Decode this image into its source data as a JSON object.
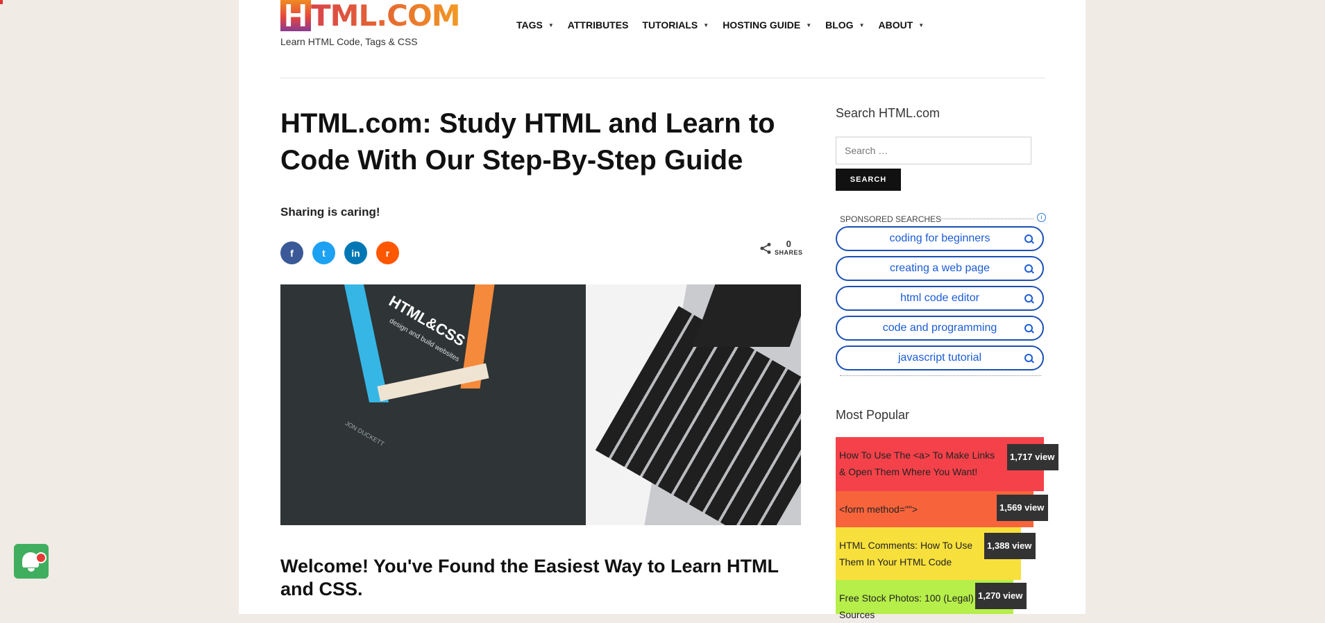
{
  "header": {
    "logo_h": "H",
    "logo_rest": "TML.COM",
    "tagline": "Learn HTML Code, Tags & CSS",
    "nav": [
      {
        "label": "TAGS",
        "has_caret": true
      },
      {
        "label": "ATTRIBUTES",
        "has_caret": false
      },
      {
        "label": "TUTORIALS",
        "has_caret": true
      },
      {
        "label": "HOSTING GUIDE",
        "has_caret": true
      },
      {
        "label": "BLOG",
        "has_caret": true
      },
      {
        "label": "ABOUT",
        "has_caret": true
      }
    ]
  },
  "main": {
    "title": "HTML.com: Study HTML and Learn to Code With Our Step-By-Step Guide",
    "sharing_text": "Sharing is caring!",
    "social": [
      {
        "icon": "facebook-icon",
        "glyph": "f",
        "color": "#3b5998"
      },
      {
        "icon": "twitter-icon",
        "glyph": "t",
        "color": "#1da1f2"
      },
      {
        "icon": "linkedin-icon",
        "glyph": "in",
        "color": "#0077b5"
      },
      {
        "icon": "reddit-icon",
        "glyph": "r",
        "color": "#ff5700"
      }
    ],
    "shares_count": "0",
    "shares_label": "SHARES",
    "hero": {
      "book_title": "HTML&CSS",
      "book_subtitle": "design and build websites",
      "book_author": "JON DUCKETT"
    },
    "welcome_heading": "Welcome! You've Found the Easiest Way to Learn HTML and CSS."
  },
  "sidebar": {
    "search_heading": "Search HTML.com",
    "search_placeholder": "Search …",
    "search_button": "SEARCH",
    "sponsored_label": "SPONSORED SEARCHES",
    "sponsored": [
      "coding for beginners",
      "creating a web page",
      "html code editor",
      "code and programming",
      "javascript tutorial"
    ],
    "popular_heading": "Most Popular",
    "popular": [
      {
        "title": "How To Use The <a> To Make Links & Open Them Where You Want!",
        "views": "1,717 view",
        "color": "#f5424a"
      },
      {
        "title": "<form method=\"\">",
        "views": "1,569 view",
        "color": "#f7643c"
      },
      {
        "title": "HTML Comments: How To Use Them In Your HTML Code",
        "views": "1,388 view",
        "color": "#f7e03c"
      },
      {
        "title": "Free Stock Photos: 100 (Legal) Sources",
        "views": "1,270 view",
        "color": "#b6ee4a"
      }
    ]
  },
  "colors": {
    "page_bg": "#f0ebe4",
    "accent_blue": "#1a5bd6",
    "notification_green": "#3fae5f"
  }
}
